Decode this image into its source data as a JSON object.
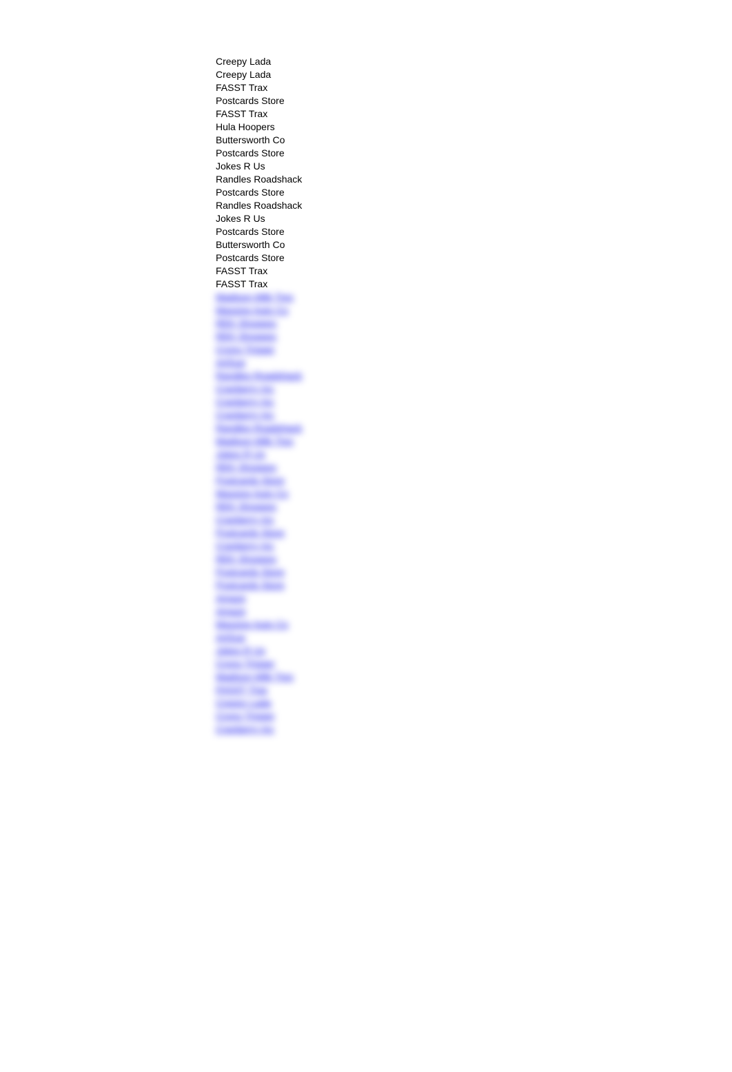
{
  "clear_items": [
    "Creepy Lada",
    "Creepy Lada",
    "FASST Trax",
    "Postcards Store",
    "FASST Trax",
    "Hula Hoopers",
    "Buttersworth Co",
    "Postcards Store",
    "Jokes R Us",
    "Randles Roadshack",
    "Postcards Store",
    "Randles Roadshack",
    "Jokes R Us",
    "Postcards Store",
    "Buttersworth Co",
    "Postcards Store",
    "FASST Trax",
    "FASST Trax"
  ],
  "blurred_items": [
    "Madison Milk Trex",
    "Massive Auto Co",
    "REK Shoppes",
    "REK Shoppes",
    "Crono Trigger",
    "ArtSup",
    "Randles Roadshack",
    "Cranberry Inc",
    "Cranberry Inc",
    "Cranberry Inc",
    "Randles Roadshack",
    "Madison Milk Trex",
    "Jokes R Us",
    "REK Shoppes",
    "Postcards Store",
    "Massive Auto Co",
    "REK Shoppes",
    "Cranberry Inc",
    "Postcards Store",
    "Cranberry Inc",
    "REK Shoppes",
    "Postcards Store",
    "Postcards Store",
    "Amaze",
    "Amaze",
    "Massive Auto Co",
    "ArtSup",
    "Jokes R Us",
    "Crono Trigger",
    "Madison Milk Trex",
    "FASST Trax",
    "Creepy Lada",
    "Crono Trigger",
    "Cranberry Inc"
  ]
}
